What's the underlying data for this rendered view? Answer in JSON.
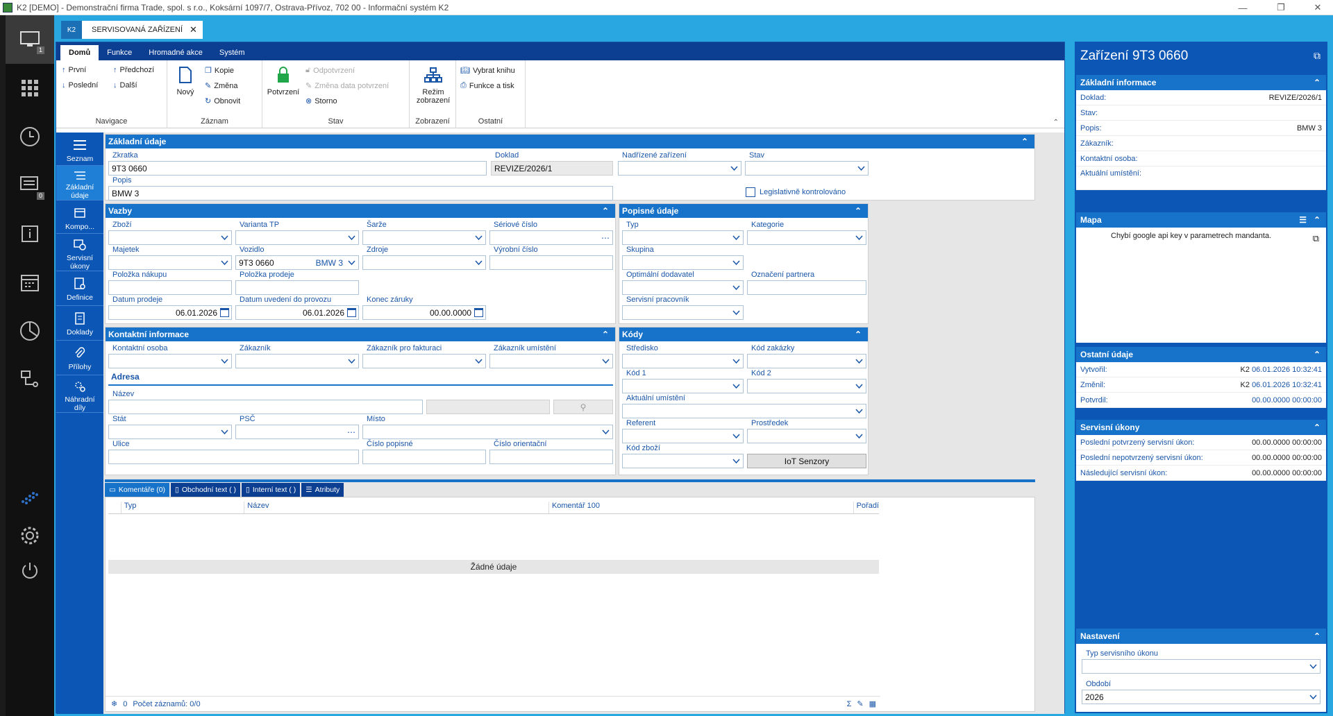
{
  "window": {
    "title": "K2 [DEMO] - Demonstrační firma Trade, spol. s r.o., Koksární 1097/7, Ostrava-Přívoz, 702 00 - Informační systém K2"
  },
  "sidenav": {
    "badge_1": "1",
    "badge_2": "0"
  },
  "tabs": {
    "k2": "K2",
    "main": "SERVISOVANÁ ZAŘÍZENÍ"
  },
  "menu": [
    "Domů",
    "Funkce",
    "Hromadné akce",
    "Systém"
  ],
  "ribbon": {
    "nav": {
      "first": "První",
      "prev": "Předchozí",
      "last": "Poslední",
      "next": "Další",
      "label": "Navigace"
    },
    "record": {
      "new": "Nový",
      "copy": "Kopie",
      "change": "Změna",
      "refresh": "Obnovit",
      "label": "Záznam"
    },
    "state": {
      "confirm": "Potvrzení",
      "unconfirm": "Odpotvrzení",
      "change_date": "Změna data potvrzení",
      "cancel": "Storno",
      "label": "Stav"
    },
    "view": {
      "mode_1": "Režim",
      "mode_2": "zobrazení",
      "label": "Zobrazení"
    },
    "other": {
      "book": "Vybrat knihu",
      "print": "Funkce a tisk",
      "label": "Ostatní"
    }
  },
  "formnav": [
    {
      "label": "Seznam"
    },
    {
      "label": "Základní údaje"
    },
    {
      "label": "Kompo..."
    },
    {
      "label": "Servisní úkony"
    },
    {
      "label": "Definice"
    },
    {
      "label": "Doklady"
    },
    {
      "label": "Přílohy"
    },
    {
      "label": "Náhradní díly"
    }
  ],
  "basic": {
    "title": "Základní údaje",
    "zkratka_label": "Zkratka",
    "zkratka": "9T3 0660",
    "doklad_label": "Doklad",
    "doklad": "REVIZE/2026/1",
    "parent_label": "Nadřízené zařízení",
    "stav_label": "Stav",
    "popis_label": "Popis",
    "popis": "BMW 3",
    "legis_label": "Legislativně kontrolováno"
  },
  "vazby": {
    "title": "Vazby",
    "zbozi": "Zboží",
    "varianta": "Varianta TP",
    "sarze": "Šarže",
    "seriove": "Sériové číslo",
    "majetek": "Majetek",
    "vozidlo": "Vozidlo",
    "vozidlo_val": "9T3 0660",
    "vozidlo_ref": "BMW 3",
    "zdroje": "Zdroje",
    "vyrobni": "Výrobní číslo",
    "pol_nakupu": "Položka nákupu",
    "pol_prodeje": "Položka prodeje",
    "datum_prodeje": "Datum prodeje",
    "datum_prodeje_val": "06.01.2026",
    "datum_uvedeni": "Datum uvedení do provozu",
    "datum_uvedeni_val": "06.01.2026",
    "konec_zaruky": "Konec záruky",
    "konec_zaruky_val": "00.00.0000"
  },
  "popisne": {
    "title": "Popisné údaje",
    "typ": "Typ",
    "kategorie": "Kategorie",
    "skupina": "Skupina",
    "opt_dodavatel": "Optimální dodavatel",
    "oznaceni": "Označení partnera",
    "pracovnik": "Servisní pracovník"
  },
  "kontakt": {
    "title": "Kontaktní informace",
    "osoba": "Kontaktní osoba",
    "zakaznik": "Zákazník",
    "fakturace": "Zákazník pro fakturaci",
    "umisteni": "Zákazník umístění",
    "adresa": "Adresa",
    "nazev": "Název",
    "stat": "Stát",
    "psc": "PSČ",
    "misto": "Místo",
    "ulice": "Ulice",
    "cislo_pop": "Číslo popisné",
    "cislo_or": "Číslo orientační"
  },
  "kody": {
    "title": "Kódy",
    "stredisko": "Středisko",
    "zakazka": "Kód zakázky",
    "kod1": "Kód 1",
    "kod2": "Kód 2",
    "umisteni": "Aktuální umístění",
    "referent": "Referent",
    "prostredek": "Prostředek",
    "kod_zbozi": "Kód zboží",
    "iot": "IoT Senzory"
  },
  "bottom_tabs": [
    "Komentáře (0)",
    "Obchodní text ( )",
    "Interní text ( )",
    "Atributy"
  ],
  "grid": {
    "cols": [
      "Typ",
      "Název",
      "Komentář 100",
      "Pořadí"
    ],
    "empty": "Žádné údaje",
    "count": "0",
    "records": "Počet záznamů: 0/0"
  },
  "right": {
    "title": "Zařízení 9T3 0660",
    "basic_title": "Základní informace",
    "basic": [
      {
        "l": "Doklad:",
        "v": "REVIZE/2026/1"
      },
      {
        "l": "Stav:",
        "v": ""
      },
      {
        "l": "Popis:",
        "v": "BMW 3"
      },
      {
        "l": "Zákazník:",
        "v": ""
      },
      {
        "l": "Kontaktní osoba:",
        "v": ""
      },
      {
        "l": "Aktuální umístění:",
        "v": ""
      }
    ],
    "map_title": "Mapa",
    "map_msg": "Chybí google api key v parametrech mandanta.",
    "other_title": "Ostatní údaje",
    "other": [
      {
        "l": "Vytvořil:",
        "u": "K2",
        "v": "06.01.2026 10:32:41"
      },
      {
        "l": "Změnil:",
        "u": "K2",
        "v": "06.01.2026 10:32:41"
      },
      {
        "l": "Potvrdil:",
        "u": "",
        "v": "00.00.0000 00:00:00"
      }
    ],
    "service_title": "Servisní úkony",
    "service": [
      {
        "l": "Poslední potvrzený servisní úkon:",
        "v": "00.00.0000 00:00:00"
      },
      {
        "l": "Poslední nepotvrzený servisní úkon:",
        "v": "00.00.0000 00:00:00"
      },
      {
        "l": "Následující servisní úkon:",
        "v": "00.00.0000 00:00:00"
      }
    ],
    "settings_title": "Nastavení",
    "typ_label": "Typ servisního úkonu",
    "obdobi_label": "Období",
    "obdobi": "2026"
  },
  "colors": {
    "accent": "#1772c9",
    "navy": "#0c3e92",
    "sky": "#29a7e1",
    "label": "#1a56a8"
  }
}
